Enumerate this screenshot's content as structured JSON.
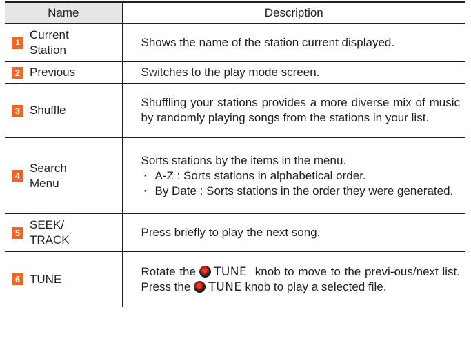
{
  "table": {
    "headers": {
      "name": "Name",
      "description": "Description"
    },
    "rows": [
      {
        "number": "1",
        "name_lines": [
          "Current",
          "Station"
        ],
        "description": "Shows the name of the station current displayed."
      },
      {
        "number": "2",
        "name_lines": [
          "Previous"
        ],
        "description": "Switches to the play mode screen."
      },
      {
        "number": "3",
        "name_lines": [
          "Shuffle"
        ],
        "description": "Shuffling your stations provides a more diverse mix of music by randomly playing songs from the stations in your list."
      },
      {
        "number": "4",
        "name_lines": [
          "Search",
          "Menu"
        ],
        "description": "Sorts stations by the items in the menu.",
        "bullets": [
          "A-Z : Sorts stations in alphabetical order.",
          "By Date : Sorts stations in the order they were generated."
        ]
      },
      {
        "number": "5",
        "name_lines": [
          "SEEK/",
          "TRACK"
        ],
        "description": "Press briefly to play the next song."
      },
      {
        "number": "6",
        "name_lines": [
          "TUNE"
        ],
        "description_parts": {
          "p1": "Rotate the",
          "knob_label": "TUNE",
          "p2": "knob to move to the previ-ous/next list. Press the",
          "p3": "knob to play a selected file."
        }
      }
    ]
  },
  "colors": {
    "badge": "#f26522",
    "header_name_bg": "#e6e6e6",
    "knob": "#c42418",
    "text": "#231f20"
  }
}
